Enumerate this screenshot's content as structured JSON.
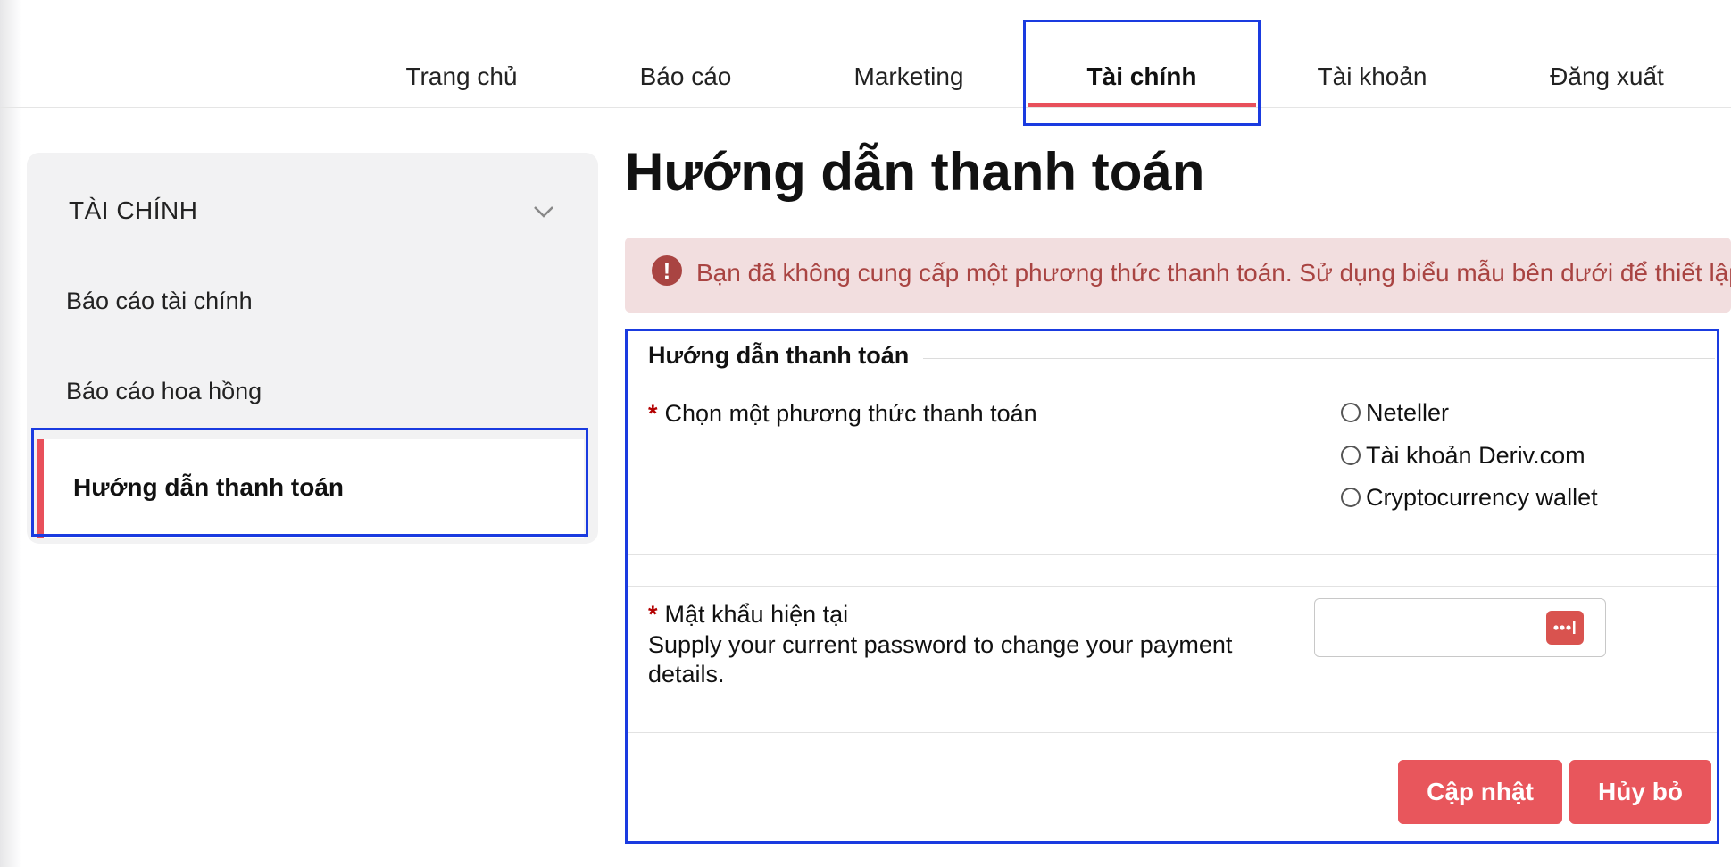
{
  "nav": {
    "items": [
      "Trang chủ",
      "Báo cáo",
      "Marketing",
      "Tài chính",
      "Tài khoản",
      "Đăng xuất"
    ],
    "active": "Tài chính"
  },
  "sidebar": {
    "heading": "TÀI CHÍNH",
    "items": [
      "Báo cáo tài chính",
      "Báo cáo hoa hồng",
      "Hướng dẫn thanh toán"
    ],
    "active_item": "Hướng dẫn thanh toán"
  },
  "main": {
    "title": "Hướng dẫn thanh toán",
    "alert": "Bạn đã không cung cấp một phương thức thanh toán. Sử dụng biểu mẫu bên dưới để thiết lập",
    "form": {
      "legend": "Hướng dẫn thanh toán",
      "required_mark": "*",
      "method_label": "Chọn một phương thức thanh toán",
      "methods": [
        "Neteller",
        "Tài khoản Deriv.com",
        "Cryptocurrency wallet"
      ],
      "password_label": "Mật khẩu hiện tại",
      "password_desc": "Supply your current password to change your payment details.",
      "password_value": "",
      "update_button": "Cập nhật",
      "cancel_button": "Hủy bỏ"
    }
  },
  "colors": {
    "accent": "#e8505b",
    "highlight": "#1a3be0",
    "alert_bg": "#f2dedf",
    "alert_text": "#a94442"
  }
}
